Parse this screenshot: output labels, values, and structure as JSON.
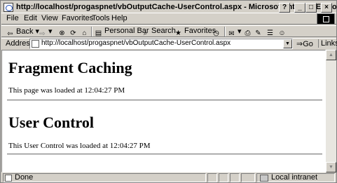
{
  "window": {
    "title": "http://localhost/progaspnet/vbOutputCache-UserControl.aspx - Microsoft Internet Explorer",
    "help_label": "?",
    "min_label": "_",
    "max_label": "□",
    "close_label": "×"
  },
  "menu": {
    "file": "File",
    "edit": "Edit",
    "view": "View",
    "favorites": "Favorites",
    "tools": "Tools",
    "help": "Help"
  },
  "toolbar": {
    "back": "Back",
    "back_glyph": "⇦",
    "forward_glyph": "⇨",
    "stop_glyph": "⊗",
    "refresh_glyph": "⟳",
    "home_glyph": "⌂",
    "personal_bar": "Personal Bar",
    "personal_bar_glyph": "▤",
    "search": "Search",
    "search_glyph": "⌕",
    "favorites": "Favorites",
    "favorites_glyph": "★",
    "history_glyph": "◷",
    "mail_glyph": "✉",
    "print_glyph": "⎙",
    "edit_glyph": "✎",
    "discuss_glyph": "☰",
    "messenger_glyph": "☺"
  },
  "address": {
    "label": "Address",
    "url": "http://localhost/progaspnet/vbOutputCache-UserControl.aspx",
    "dropdown_glyph": "▼",
    "go": "Go",
    "go_glyph": "⇒",
    "links": "Links"
  },
  "page": {
    "heading1": "Fragment Caching",
    "para1": "This page was loaded at 12:04:27 PM",
    "heading2": "User Control",
    "para2": "This User Control was loaded at 12:04:27 PM"
  },
  "scrollbar": {
    "up_glyph": "▲",
    "down_glyph": "▼"
  },
  "status": {
    "text": "Done",
    "zone": "Local intranet"
  },
  "icons": {
    "title": "ie-page-icon",
    "address": "page-icon",
    "status": "page-icon",
    "zone": "intranet-icon"
  },
  "colors": {
    "chrome": "#d4d0c8",
    "content_bg": "#ffffff"
  }
}
